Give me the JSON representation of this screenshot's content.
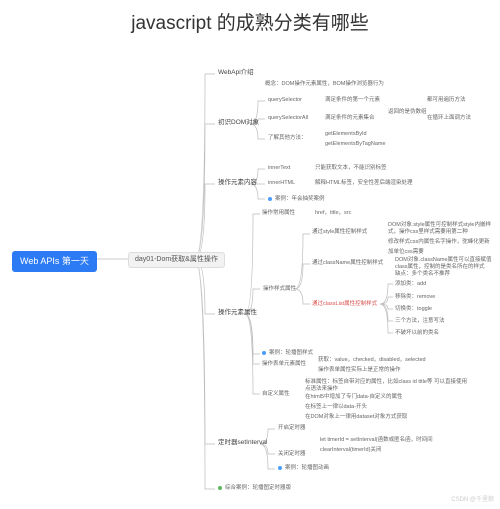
{
  "title": "javascript 的成熟分类有哪些",
  "root": "Web APIs 第一天",
  "lvl1": "day01-Dom获取&属性操作",
  "sec1": {
    "label": "WebApi介绍",
    "items": [
      "概念：DOM操作元素属性，BOM操作浏览器行为"
    ]
  },
  "sec2": {
    "label": "初识DOM对象",
    "sub1": "querySelector",
    "sub1_note": "满足条件的第一个元素",
    "sub2": "querySelectorAll",
    "sub2_note": "满足条件的元素集合",
    "sub2_r1": "返回的是伪数组",
    "sub2_r2": "都可用遍历方法",
    "sub2_r3": "在循环上面调方法",
    "sub3": "了解其他方法：",
    "sub3_note": "getElementsById",
    "sub3_note2": "getElementsByTagName"
  },
  "sec3": {
    "label": "操作元素内容",
    "a": "innerText",
    "a_note": "只能获取文本，不能识别标签",
    "b": "innerHTML",
    "b_note": "解释HTML标签，安全性差后端渲染处理",
    "case": "案例：年会抽奖案例"
  },
  "sec4": {
    "label": "操作元素属性",
    "a": "操作常用属性",
    "a_note": "href，title，src",
    "b_title": "操作样式属性",
    "b1": "通过style属性控制样式",
    "b1_n1": "DOM对象.style属性可控制样式style内嵌样式，操作css里样式需要用第二种",
    "b1_n2": "修改样式css内属性名字操作，驼峰化更新",
    "b1_n3": "加单位css需要",
    "b2": "通过className属性控制样式",
    "b2_n1": "DOM对象.className属性可以直接赋值class属性，控制的是类名所在的样式",
    "b2_n2": "缺点：多个类名不推荐",
    "b3": "通过classList属性控制样式",
    "b3_a": "添加类：add",
    "b3_b": "移除类：remove",
    "b3_c": "切换类：toggle",
    "b3_d": "三个方法，注意写法",
    "b3_e": "不破坏以前的类名",
    "case": "案例：轮播图样式",
    "c": "操作表单元素属性",
    "c_note1": "获取：value，checked，disabled，selected",
    "c_note2": "操作表单属性实际上是正常的操作",
    "d": "自定义属性",
    "d_n1": "标准属性：标签自带对应的属性，比如class id title等 可以直接使用点语法来操作",
    "d_n2": "在html5中增加了专门data-自定义的属性",
    "d_n3": "在标签上一律以data-开头",
    "d_n4": "在DOM对象上一律用dataset对象方式获取"
  },
  "sec5": {
    "label": "定时器setInterval",
    "a": "开启定时器",
    "a_n1": "let timerId = setInterval(函数或匿名函，时间间",
    "a_n2": "clearInterval(timerId)关闭",
    "b": "关闭定时器",
    "case": "案例：轮播图动画"
  },
  "sec6": "综合案例：轮播图定时器版",
  "watermark": "CSDN @千里狼"
}
